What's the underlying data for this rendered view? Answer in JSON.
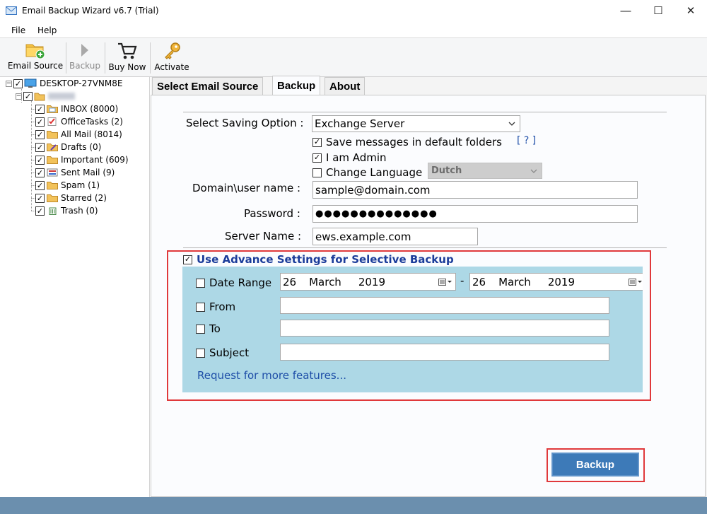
{
  "window": {
    "title": "Email Backup Wizard v6.7 (Trial)",
    "minimize": "—",
    "maximize": "☐",
    "close": "✕"
  },
  "menu": {
    "file": "File",
    "help": "Help"
  },
  "toolbar": {
    "email_source": "Email Source",
    "backup": "Backup",
    "buy_now": "Buy Now",
    "activate": "Activate"
  },
  "tree": {
    "computer": "DESKTOP-27VNM8E",
    "account": "",
    "folders": [
      {
        "label": "INBOX (8000)",
        "icon": "inbox-folder-icon"
      },
      {
        "label": "OfficeTasks (2)",
        "icon": "tasks-folder-icon"
      },
      {
        "label": "All Mail (8014)",
        "icon": "folder-icon"
      },
      {
        "label": "Drafts (0)",
        "icon": "drafts-folder-icon"
      },
      {
        "label": "Important (609)",
        "icon": "folder-icon"
      },
      {
        "label": "Sent Mail (9)",
        "icon": "sent-folder-icon"
      },
      {
        "label": "Spam (1)",
        "icon": "folder-icon"
      },
      {
        "label": "Starred (2)",
        "icon": "folder-icon"
      },
      {
        "label": "Trash (0)",
        "icon": "trash-folder-icon"
      }
    ]
  },
  "tabs": {
    "select_email_source": "Select Email Source",
    "backup": "Backup",
    "about": "About"
  },
  "form": {
    "saving_option_label": "Select Saving Option :",
    "saving_option_value": "Exchange Server",
    "save_default_folders": "Save messages in default folders",
    "help_link": "[ ? ]",
    "i_am_admin": "I am Admin",
    "change_language": "Change Language",
    "language_value": "Dutch",
    "domain_label": "Domain\\user name :",
    "domain_value": "sample@domain.com",
    "password_label": "Password :",
    "password_value": "●●●●●●●●●●●●●●",
    "server_label": "Server Name :",
    "server_value": "ews.example.com"
  },
  "advanced": {
    "title": "Use Advance Settings for Selective Backup",
    "date_range_label": "Date Range",
    "date_from": {
      "day": "26",
      "month": "March",
      "year": "2019"
    },
    "date_separator": "-",
    "date_to": {
      "day": "26",
      "month": "March",
      "year": "2019"
    },
    "from_label": "From",
    "to_label": "To",
    "subject_label": "Subject",
    "request_link": "Request for more features..."
  },
  "backup_button": "Backup",
  "colors": {
    "advanced_panel": "#add8e6",
    "highlight_outline": "#e0393b",
    "backup_button": "#3d7ab8",
    "link": "#1f4fa8"
  }
}
